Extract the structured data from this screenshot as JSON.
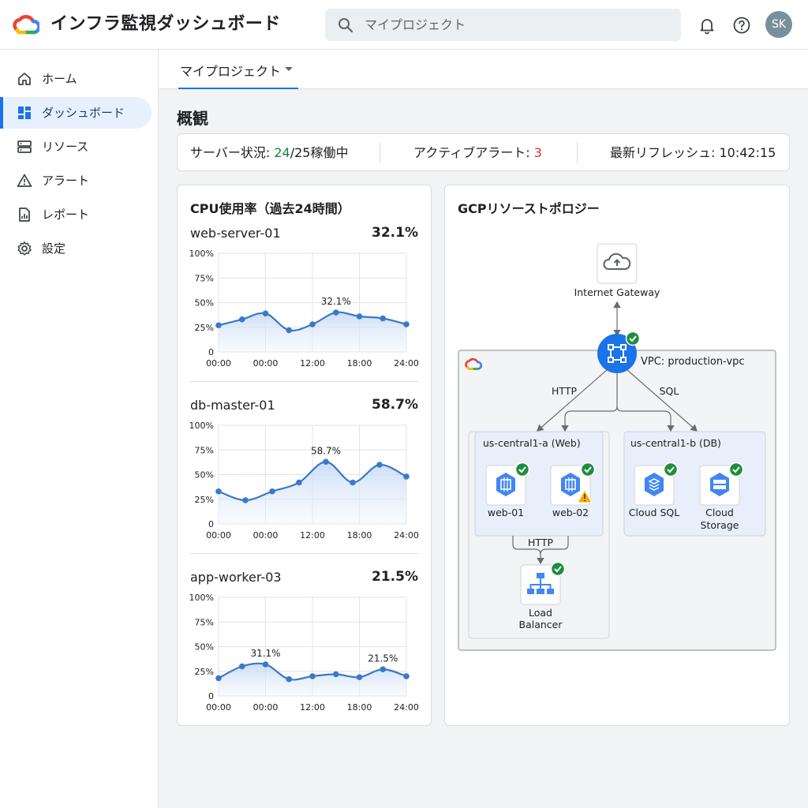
{
  "header": {
    "title": "インフラ監視ダッシュボード",
    "search_placeholder": "マイプロジェクト",
    "avatar_initials": "SK"
  },
  "sidebar": {
    "items": [
      {
        "label": "ホーム",
        "icon": "home-icon"
      },
      {
        "label": "ダッシュボード",
        "icon": "dashboard-icon",
        "active": true
      },
      {
        "label": "リソース",
        "icon": "storage-icon"
      },
      {
        "label": "アラート",
        "icon": "warning-icon"
      },
      {
        "label": "レポート",
        "icon": "report-icon"
      },
      {
        "label": "設定",
        "icon": "gear-icon"
      }
    ]
  },
  "project_tab": {
    "label": "マイプロジェクト"
  },
  "overview": {
    "title": "概観",
    "server_status_label": "サーバー状況: ",
    "server_running": "24",
    "server_total_suffix": "/25稼働中",
    "alerts_label": "アクティブアラート: ",
    "alerts_count": "3",
    "refresh_label": "最新リフレッシュ: 10:42:15"
  },
  "colors": {
    "accent": "#1a73e8",
    "ok": "#188038",
    "alert": "#d93025",
    "line": "#3a78c9"
  },
  "cpu_card": {
    "title": "CPU使用率（過去24時間）",
    "charts": [
      {
        "name": "web-server-01",
        "value": "32.1%",
        "chart_data": {
          "type": "line",
          "x_ticks": [
            "00:00",
            "00:00",
            "12:00",
            "18:00",
            "24:00"
          ],
          "y_ticks": [
            "100%",
            "75%",
            "50%",
            "25%",
            "0"
          ],
          "ylim": [
            0,
            100
          ],
          "values": [
            27,
            33,
            39,
            22,
            28,
            40,
            36,
            34,
            28
          ],
          "annotations": [
            {
              "index": 5,
              "text": "32.1%"
            }
          ]
        }
      },
      {
        "name": "db-master-01",
        "value": "58.7%",
        "chart_data": {
          "type": "line",
          "x_ticks": [
            "00:00",
            "00:00",
            "12:00",
            "18:00",
            "24:00"
          ],
          "y_ticks": [
            "100%",
            "75%",
            "50%",
            "25%",
            "0"
          ],
          "ylim": [
            0,
            100
          ],
          "values": [
            33,
            24,
            33,
            42,
            63,
            42,
            60,
            48
          ],
          "annotations": [
            {
              "index": 4,
              "text": "58.7%"
            }
          ]
        }
      },
      {
        "name": "app-worker-03",
        "value": "21.5%",
        "chart_data": {
          "type": "line",
          "x_ticks": [
            "00:00",
            "00:00",
            "12:00",
            "18:00",
            "24:00"
          ],
          "y_ticks": [
            "100%",
            "75%",
            "50%",
            "25%",
            "0"
          ],
          "ylim": [
            0,
            100
          ],
          "values": [
            18,
            30,
            32,
            17,
            20,
            22,
            19,
            27,
            20
          ],
          "annotations": [
            {
              "index": 2,
              "text": "31.1%"
            },
            {
              "index": 7,
              "text": "21.5%"
            }
          ]
        }
      }
    ]
  },
  "topology": {
    "title": "GCPリソーストポロジー",
    "internet_gateway": "Internet Gateway",
    "vpc_label": "VPC: production-vpc",
    "link_http": "HTTP",
    "link_sql": "SQL",
    "zone_web": "us-central1-a (Web)",
    "zone_db": "us-central1-b (DB)",
    "web01": "web-01",
    "web02": "web-02",
    "cloud_sql": "Cloud SQL",
    "cloud_storage_1": "Cloud",
    "cloud_storage_2": "Storage",
    "lb_http": "HTTP",
    "lb_1": "Load",
    "lb_2": "Balancer"
  }
}
